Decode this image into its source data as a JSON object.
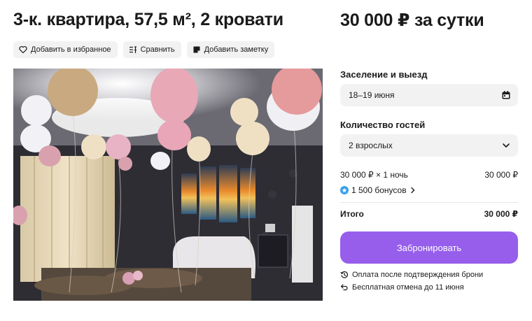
{
  "listing": {
    "title": "3-к. квартира, 57,5 м², 2 кровати",
    "actions": [
      {
        "label": "Добавить в избранное",
        "icon": "heart-icon"
      },
      {
        "label": "Сравнить",
        "icon": "compare-icon"
      },
      {
        "label": "Добавить заметку",
        "icon": "note-icon"
      }
    ],
    "photo": {
      "alt": "Фото квартиры"
    }
  },
  "booking": {
    "price": "30 000 ₽ за сутки",
    "checkin_label": "Заселение и выезд",
    "checkin_value": "18–19 июня",
    "guests_label": "Количество гостей",
    "guests_value": "2 взрослых",
    "calc_label": "30 000 ₽ × 1 ночь",
    "calc_value": "30 000 ₽",
    "bonus_label": "1 500 бонусов",
    "total_label": "Итого",
    "total_value": "30 000 ₽",
    "book_button": "Забронировать",
    "note_payment": "Оплата после подтверждения брони",
    "note_cancel": "Бесплатная отмена до 11 июня"
  },
  "colors": {
    "accent": "#965eeb",
    "field_bg": "#f2f2f2",
    "bonus_star": "#3aa0e8"
  }
}
